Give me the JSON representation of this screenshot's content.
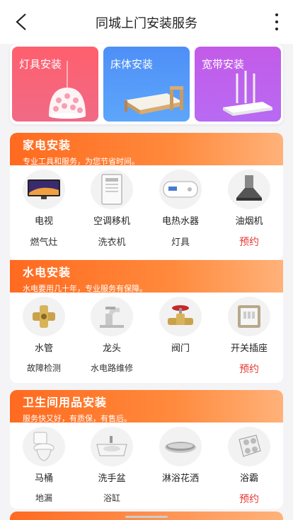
{
  "header": {
    "title": "同城上门安装服务",
    "back_icon": "chevron-left-icon",
    "more_icon": "more-vertical-icon"
  },
  "categories": [
    {
      "label": "灯具安装",
      "color": "#ff5f6d"
    },
    {
      "label": "床体安装",
      "color": "#4e8ff7"
    },
    {
      "label": "宽带安装",
      "color": "#c35be8"
    }
  ],
  "appliance": {
    "title": "家电安装",
    "subtitle": "专业工具和服务，为您节省时间。",
    "items": [
      "电视",
      "空调移机",
      "电热水器",
      "油烟机"
    ],
    "row2": [
      "燃气灶",
      "洗衣机",
      "灯具"
    ],
    "reserve": "预约"
  },
  "plumbing": {
    "title": "水电安装",
    "subtitle": "水电要用几十年，专业服务有保障。",
    "items": [
      "水管",
      "龙头",
      "阀门",
      "开关插座"
    ],
    "row2": [
      "故障检测",
      "水电路维修"
    ],
    "reserve": "预约"
  },
  "bathroom": {
    "title": "卫生间用品安装",
    "subtitle": "服务快又好，有质保，有售后。",
    "items": [
      "马桶",
      "洗手盆",
      "淋浴花洒",
      "浴霸"
    ],
    "row2": [
      "地漏",
      "浴缸"
    ],
    "reserve": "预约"
  },
  "accent_color": "#ff6a1f",
  "reserve_color": "#e53935"
}
